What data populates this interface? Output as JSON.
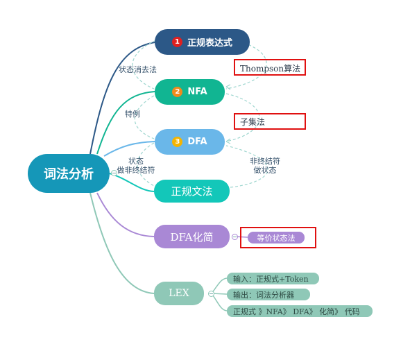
{
  "root": {
    "label": "词法分析"
  },
  "branches": {
    "regex": {
      "number": "1",
      "label": "正规表达式"
    },
    "nfa": {
      "number": "2",
      "label": "NFA"
    },
    "dfa": {
      "number": "3",
      "label": "DFA"
    },
    "grammar": {
      "label": "正规文法"
    },
    "dfa_min": {
      "label": "DFA化简"
    },
    "lex": {
      "label": "LEX"
    }
  },
  "relations": {
    "state_elimination": "状态消去法",
    "special_case": "特例",
    "state_as_nonterminal": [
      "状态",
      "做非终结符"
    ],
    "nonterminal_as_state": [
      "非终结符",
      "做状态"
    ]
  },
  "highlighted": {
    "thompson": "Thompson算法",
    "subset": "子集法"
  },
  "children": {
    "dfa_min": [
      "等价状态法"
    ],
    "lex": [
      "输入：正规式+Token",
      "输出：词法分析器",
      "正规式 》NFA》 DFA》 化简》 代码"
    ]
  },
  "colors": {
    "root": "#1597b8",
    "regex": "#2c5887",
    "nfa": "#11b592",
    "dfa": "#6ab7e9",
    "grammar": "#13c7b9",
    "dfa_min": "#a988d5",
    "lex": "#8fc8b7",
    "highlight_border": "#e01010"
  }
}
